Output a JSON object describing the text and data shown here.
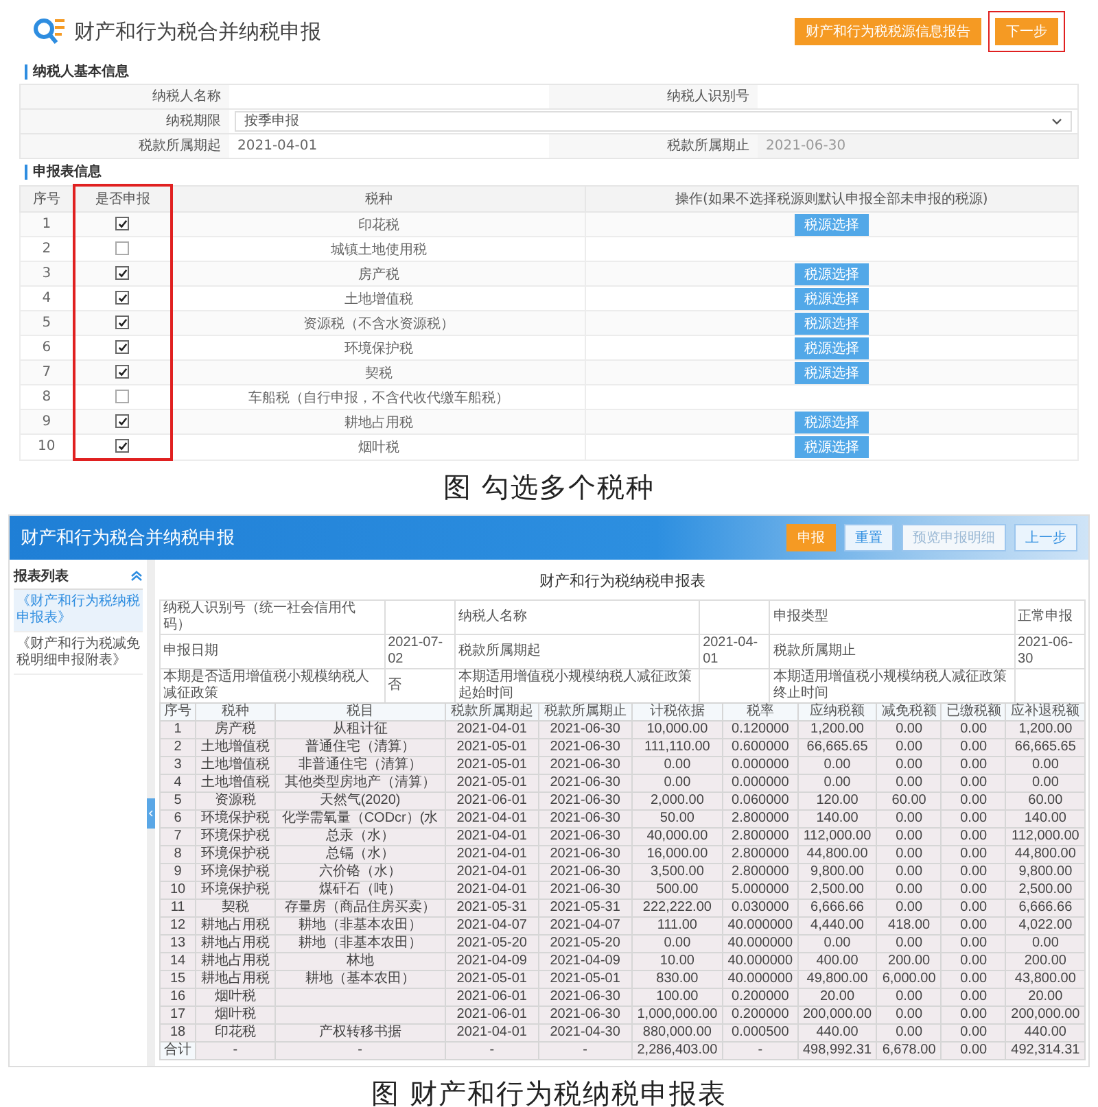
{
  "figure_1": {
    "header": {
      "title": "财产和行为税合并纳税申报",
      "buttons": [
        {
          "label": "财产和行为税税源信息报告",
          "highlighted": false
        },
        {
          "label": "下一步",
          "highlighted": true
        }
      ]
    },
    "taxpayer_section": {
      "title": "纳税人基本信息",
      "rows": [
        [
          {
            "label": "纳税人名称",
            "kind": "text"
          },
          {
            "label": "纳税人识别号",
            "kind": "text"
          }
        ],
        [
          {
            "label": "纳税期限",
            "kind": "select",
            "value": "按季申报"
          }
        ],
        [
          {
            "label": "税款所属期起",
            "kind": "text",
            "value": "2021-04-01"
          },
          {
            "label": "税款所属期止",
            "kind": "text",
            "value": "2021-06-30"
          }
        ]
      ]
    },
    "declaration_section": {
      "title": "申报表信息",
      "columns": [
        {
          "label": "序号",
          "highlighted": false
        },
        {
          "label": "是否申报",
          "highlighted": true
        },
        {
          "label": "税种",
          "highlighted": false
        },
        {
          "label": "操作(如果不选择税源则默认申报全部未申报的税源)",
          "highlighted": false
        }
      ],
      "rows": [
        {
          "no": "1",
          "checked": true,
          "tax": "印花税",
          "action": "税源选择"
        },
        {
          "no": "2",
          "checked": false,
          "tax": "城镇土地使用税"
        },
        {
          "no": "3",
          "checked": true,
          "tax": "房产税",
          "action": "税源选择"
        },
        {
          "no": "4",
          "checked": true,
          "tax": "土地增值税",
          "action": "税源选择"
        },
        {
          "no": "5",
          "checked": true,
          "tax": "资源税（不含水资源税）",
          "action": "税源选择"
        },
        {
          "no": "6",
          "checked": true,
          "tax": "环境保护税",
          "action": "税源选择"
        },
        {
          "no": "7",
          "checked": true,
          "tax": "契税",
          "action": "税源选择"
        },
        {
          "no": "8",
          "checked": false,
          "tax": "车船税（自行申报，不含代收代缴车船税）"
        },
        {
          "no": "9",
          "checked": true,
          "tax": "耕地占用税",
          "action": "税源选择"
        },
        {
          "no": "10",
          "checked": true,
          "tax": "烟叶税",
          "action": "税源选择"
        }
      ]
    },
    "caption": "图  勾选多个税种"
  },
  "figure_2": {
    "app_title": "财产和行为税合并纳税申报",
    "toolbar": [
      {
        "label": "申报",
        "kind": "primary"
      },
      {
        "label": "重置",
        "kind": "default"
      },
      {
        "label": "预览申报明细",
        "kind": "muted"
      },
      {
        "label": "上一步",
        "kind": "default"
      }
    ],
    "sidebar": {
      "title": "报表列表",
      "items": [
        {
          "label": "《财产和行为税纳税申报表》",
          "selected": true
        },
        {
          "label": "《财产和行为税减免税明细申报附表》",
          "selected": false
        }
      ]
    },
    "report_title": "财产和行为税纳税申报表",
    "info_rows": [
      [
        "纳税人识别号（统一社会信用代码）",
        null,
        "纳税人名称",
        null,
        "申报类型",
        "正常申报"
      ],
      [
        "申报日期",
        "2021-07-02",
        "税款所属期起",
        "2021-04-01",
        "税款所属期止",
        "2021-06-30"
      ],
      [
        "本期是否适用增值税小规模纳税人减征政策",
        "否",
        "本期适用增值税小规模纳税人减征政策起始时间",
        null,
        "本期适用增值税小规模纳税人减征政策终止时间",
        null
      ]
    ],
    "table": {
      "columns": [
        "序号",
        "税种",
        "税目",
        "税款所属期起",
        "税款所属期止",
        "计税依据",
        "税率",
        "应纳税额",
        "减免税额",
        "已缴税额",
        "应补退税额"
      ],
      "rows": [
        [
          "1",
          "房产税",
          "从租计征",
          "2021-04-01",
          "2021-06-30",
          "10,000.00",
          "0.120000",
          "1,200.00",
          "0.00",
          "0.00",
          "1,200.00"
        ],
        [
          "2",
          "土地增值税",
          "普通住宅（清算）",
          "2021-05-01",
          "2021-06-30",
          "111,110.00",
          "0.600000",
          "66,665.65",
          "0.00",
          "0.00",
          "66,665.65"
        ],
        [
          "3",
          "土地增值税",
          "非普通住宅（清算）",
          "2021-05-01",
          "2021-06-30",
          "0.00",
          "0.000000",
          "0.00",
          "0.00",
          "0.00",
          "0.00"
        ],
        [
          "4",
          "土地增值税",
          "其他类型房地产（清算）",
          "2021-05-01",
          "2021-06-30",
          "0.00",
          "0.000000",
          "0.00",
          "0.00",
          "0.00",
          "0.00"
        ],
        [
          "5",
          "资源税",
          "天然气(2020)",
          "2021-06-01",
          "2021-06-30",
          "2,000.00",
          "0.060000",
          "120.00",
          "60.00",
          "0.00",
          "60.00"
        ],
        [
          "6",
          "环境保护税",
          "化学需氧量（CODcr）(水",
          "2021-04-01",
          "2021-06-30",
          "50.00",
          "2.800000",
          "140.00",
          "0.00",
          "0.00",
          "140.00"
        ],
        [
          "7",
          "环境保护税",
          "总汞（水）",
          "2021-04-01",
          "2021-06-30",
          "40,000.00",
          "2.800000",
          "112,000.00",
          "0.00",
          "0.00",
          "112,000.00"
        ],
        [
          "8",
          "环境保护税",
          "总镉（水）",
          "2021-04-01",
          "2021-06-30",
          "16,000.00",
          "2.800000",
          "44,800.00",
          "0.00",
          "0.00",
          "44,800.00"
        ],
        [
          "9",
          "环境保护税",
          "六价铬（水）",
          "2021-04-01",
          "2021-06-30",
          "3,500.00",
          "2.800000",
          "9,800.00",
          "0.00",
          "0.00",
          "9,800.00"
        ],
        [
          "10",
          "环境保护税",
          "煤矸石（吨）",
          "2021-04-01",
          "2021-06-30",
          "500.00",
          "5.000000",
          "2,500.00",
          "0.00",
          "0.00",
          "2,500.00"
        ],
        [
          "11",
          "契税",
          "存量房（商品住房买卖）",
          "2021-05-31",
          "2021-05-31",
          "222,222.00",
          "0.030000",
          "6,666.66",
          "0.00",
          "0.00",
          "6,666.66"
        ],
        [
          "12",
          "耕地占用税",
          "耕地（非基本农田）",
          "2021-04-07",
          "2021-04-07",
          "111.00",
          "40.000000",
          "4,440.00",
          "418.00",
          "0.00",
          "4,022.00"
        ],
        [
          "13",
          "耕地占用税",
          "耕地（非基本农田）",
          "2021-05-20",
          "2021-05-20",
          "0.00",
          "40.000000",
          "0.00",
          "0.00",
          "0.00",
          "0.00"
        ],
        [
          "14",
          "耕地占用税",
          "林地",
          "2021-04-09",
          "2021-04-09",
          "10.00",
          "40.000000",
          "400.00",
          "200.00",
          "0.00",
          "200.00"
        ],
        [
          "15",
          "耕地占用税",
          "耕地（基本农田）",
          "2021-05-01",
          "2021-05-01",
          "830.00",
          "40.000000",
          "49,800.00",
          "6,000.00",
          "0.00",
          "43,800.00"
        ],
        [
          "16",
          "烟叶税",
          null,
          "2021-06-01",
          "2021-06-30",
          "100.00",
          "0.200000",
          "20.00",
          "0.00",
          "0.00",
          "20.00"
        ],
        [
          "17",
          "烟叶税",
          null,
          "2021-06-01",
          "2021-06-30",
          "1,000,000.00",
          "0.200000",
          "200,000.00",
          "0.00",
          "0.00",
          "200,000.00"
        ],
        [
          "18",
          "印花税",
          "产权转移书据",
          "2021-04-01",
          "2021-04-30",
          "880,000.00",
          "0.000500",
          "440.00",
          "0.00",
          "0.00",
          "440.00"
        ]
      ],
      "total": [
        "合计",
        "-",
        "-",
        "-",
        "-",
        "2,286,403.00",
        "-",
        "498,992.31",
        "6,678.00",
        "0.00",
        "492,314.31"
      ]
    },
    "caption": "图  财产和行为税纳税申报表"
  }
}
